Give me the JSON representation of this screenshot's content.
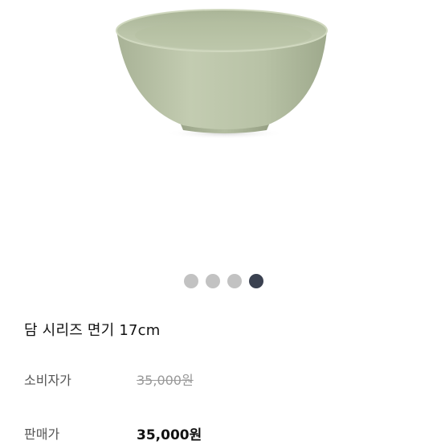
{
  "product": {
    "image": "sage-green-ceramic-bowl",
    "image_count": 4,
    "active_image_index": 4,
    "name": "담 시리즈 면기 17cm"
  },
  "pricing": {
    "list_label": "소비자가",
    "list_price": "35,000원",
    "sale_label": "판매가",
    "sale_price": "35,000원"
  },
  "colors": {
    "bowl": "#b9c3a8",
    "dot_inactive": "#c2c2c2",
    "dot_active": "#3a4150"
  }
}
